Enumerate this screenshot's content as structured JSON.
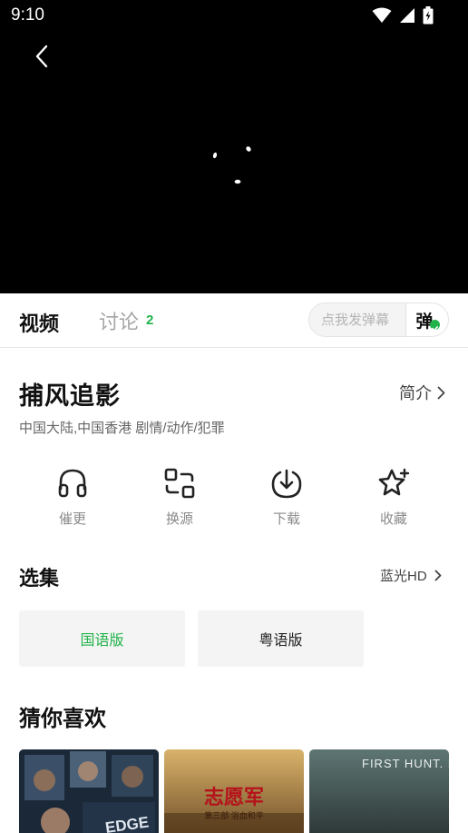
{
  "status_bar": {
    "time": "9:10"
  },
  "tabs": {
    "video": "视频",
    "discuss": "讨论",
    "discuss_count": "2"
  },
  "danmu": {
    "placeholder": "点我发弹幕",
    "toggle_label": "弹"
  },
  "movie": {
    "title": "捕风追影",
    "intro_label": "简介",
    "meta": "中国大陆,中国香港  剧情/动作/犯罪"
  },
  "actions": [
    {
      "label": "催更",
      "icon": "headphones-icon"
    },
    {
      "label": "换源",
      "icon": "switch-source-icon"
    },
    {
      "label": "下载",
      "icon": "download-icon"
    },
    {
      "label": "收藏",
      "icon": "star-icon"
    }
  ],
  "episodes": {
    "heading": "选集",
    "quality": "蓝光HD",
    "items": [
      {
        "label": "国语版",
        "selected": true
      },
      {
        "label": "粤语版",
        "selected": false
      }
    ]
  },
  "recommend": {
    "heading": "猜你喜欢",
    "posters": [
      {
        "caption": "EDGE",
        "colors": [
          "#1d2b3d",
          "#3d5a73"
        ]
      },
      {
        "caption": "志愿军",
        "subcaption": "第三部 浴血和平",
        "colors": [
          "#c9a35b",
          "#7a5a2b"
        ]
      },
      {
        "caption": "FIRST HUNT. LAST CHANCE.",
        "colors": [
          "#4f6461",
          "#26302f"
        ]
      }
    ]
  },
  "colors": {
    "accent": "#21b34a",
    "text_muted": "#8a8a8a"
  }
}
